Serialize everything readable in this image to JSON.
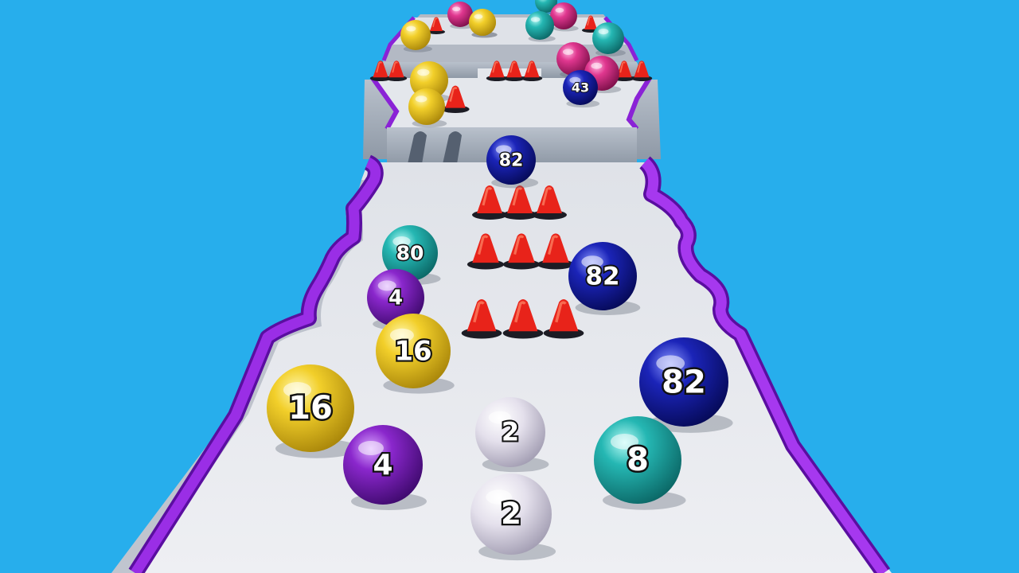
{
  "colors": {
    "sky": "#27aeec",
    "track": "#e9eaef",
    "rail": "#8a22d6",
    "wall": "#a9b2bf",
    "cone": "#e8231a"
  },
  "balls": [
    {
      "label": "",
      "color": "pink"
    },
    {
      "label": "",
      "color": "yellow"
    },
    {
      "label": "",
      "color": "teal"
    },
    {
      "label": "",
      "color": "pink"
    },
    {
      "label": "",
      "color": "yellow"
    },
    {
      "label": "",
      "color": "teal"
    },
    {
      "label": "",
      "color": "yellow"
    },
    {
      "label": "",
      "color": "teal"
    },
    {
      "label": "",
      "color": "pink"
    },
    {
      "label": "",
      "color": "pink"
    },
    {
      "label": "43",
      "color": "blue"
    },
    {
      "label": "",
      "color": "yellow"
    },
    {
      "label": "",
      "color": "yellow"
    },
    {
      "label": "82",
      "color": "blue"
    },
    {
      "label": "80",
      "color": "teal"
    },
    {
      "label": "82",
      "color": "blue"
    },
    {
      "label": "4",
      "color": "purple"
    },
    {
      "label": "16",
      "color": "yellow"
    },
    {
      "label": "82",
      "color": "blue"
    },
    {
      "label": "16",
      "color": "yellow"
    },
    {
      "label": "2",
      "color": "white"
    },
    {
      "label": "8",
      "color": "teal"
    },
    {
      "label": "4",
      "color": "purple"
    },
    {
      "label": "2",
      "color": "white"
    }
  ]
}
